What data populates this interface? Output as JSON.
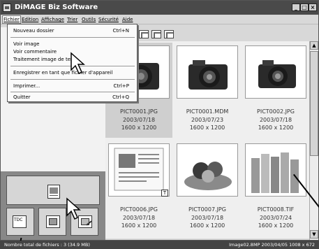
{
  "window": {
    "title": "DiMAGE Biz Software",
    "controls": [
      "_",
      "□",
      "×"
    ]
  },
  "menubar": {
    "items": [
      "Fichier",
      "Edition",
      "Affichage",
      "Trier",
      "Outils",
      "Sécurité",
      "Aide"
    ]
  },
  "file_menu": {
    "items": [
      {
        "label": "Nouveau dossier",
        "shortcut": "Ctrl+N"
      },
      {
        "label": "Voir image",
        "shortcut": ""
      },
      {
        "label": "Voir commentaire",
        "shortcut": ""
      },
      {
        "label": "Traitement image de texte",
        "shortcut": ""
      },
      {
        "label": "Enregistrer en tant que fichier d'appareil",
        "shortcut": ""
      },
      {
        "label": "Imprimer...",
        "shortcut": "Ctrl+P"
      },
      {
        "label": "Quitter",
        "shortcut": "Ctrl+Q"
      }
    ]
  },
  "thumbnails": [
    {
      "name": "PICT0001.JPG",
      "date": "2003/07/18",
      "dims": "1600 x 1200",
      "selected": true
    },
    {
      "name": "PICT0001.MDM",
      "date": "2003/07/23",
      "dims": "1600 x 1200",
      "selected": false
    },
    {
      "name": "PICT0002.JPG",
      "date": "2003/07/18",
      "dims": "1600 x 1200",
      "selected": false
    },
    {
      "name": "PICT0006.JPG",
      "date": "2003/07/18",
      "dims": "1600 x 1200",
      "selected": false
    },
    {
      "name": "PICT0007.JPG",
      "date": "2003/07/18",
      "dims": "1600 x 1200",
      "selected": false
    },
    {
      "name": "PICT0008.TIF",
      "date": "2003/07/24",
      "dims": "1600 x 1200",
      "selected": false
    }
  ],
  "status": {
    "left": "Nombre total de fichiers : 3 (34.9 MB)",
    "right": "Image02.8MP 2003/04/05 1008 x 672"
  },
  "buttons": {
    "small_1": "TDC"
  }
}
